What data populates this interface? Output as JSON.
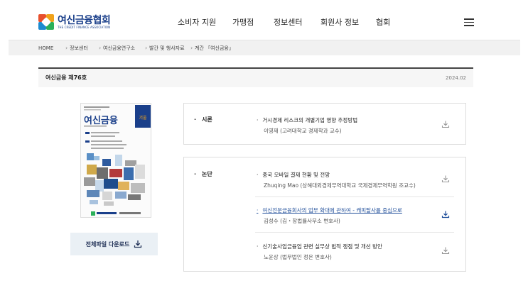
{
  "header": {
    "logo_title": "여신금융협회",
    "logo_subtitle": "THE CREDIT FINANCE ASSOCIATION",
    "nav": [
      "소비자 지원",
      "가맹점",
      "정보센터",
      "회원사 정보",
      "협회"
    ]
  },
  "breadcrumb": [
    "HOME",
    "정보센터",
    "여신금융연구소",
    "발간 및 행사자료",
    "계간 「여신금융」"
  ],
  "issue": {
    "title": "여신금융 제76호",
    "date": "2024.02"
  },
  "cover": {
    "title": "여신금융",
    "badge": "겨울"
  },
  "download_all_label": "전체파일 다운로드",
  "sections": [
    {
      "label": "시론",
      "articles": [
        {
          "title": "거시경제 리스크의 개별기업 영향 추정방법",
          "author": "이영재 (고려대학교 경제학과 교수)",
          "linked": false
        }
      ]
    },
    {
      "label": "논단",
      "articles": [
        {
          "title": "중국 모바일 결제 현황 및 전망",
          "author": "Zhuqing Mao (상해대외경제무역대학교 국제경제무역학원 조교수)",
          "linked": false
        },
        {
          "title": "여신전문금융회사의 업무 확대에 관하여 - 캐피탈사를 중심으로",
          "author": "김성수 (김・장법률사무소 변호사)",
          "linked": true
        },
        {
          "title": "신기술사업금융업 관련 실무상 법적 쟁점 및 개선 방안",
          "author": "노윤상 (법무법인 정은 변호사)",
          "linked": false
        }
      ]
    }
  ],
  "colors": {
    "brand_blue": "#1a3f8a",
    "link_blue": "#1f4e9a",
    "button_bg": "#eaf0f5"
  },
  "icons": {
    "download": "download-icon",
    "menu": "hamburger-menu-icon"
  }
}
